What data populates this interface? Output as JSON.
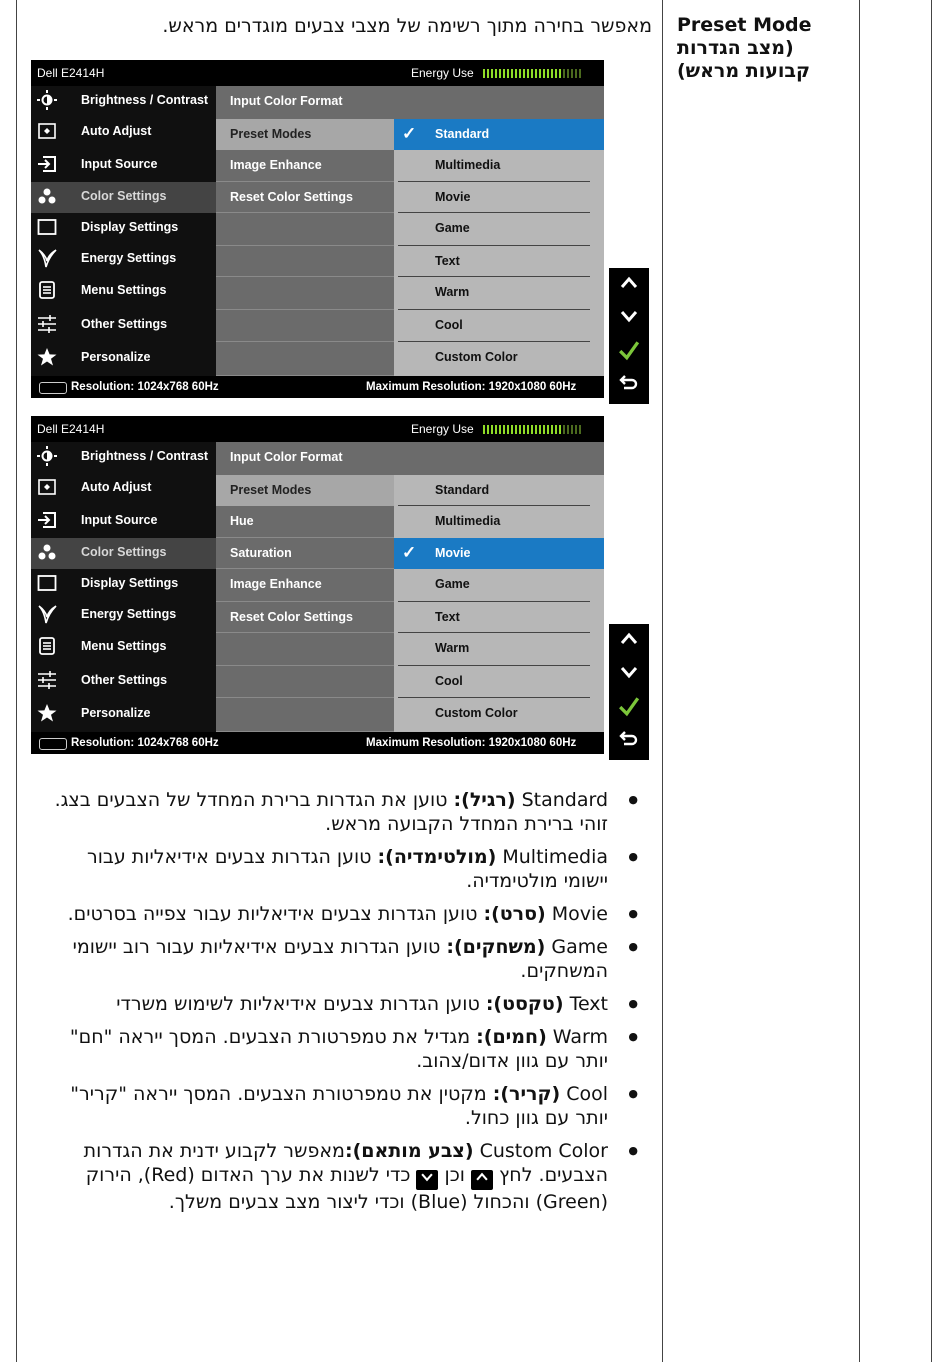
{
  "term": {
    "line1": "Preset Mode",
    "line2": "(מצב הגדרות",
    "line3": "קבועות מראש)"
  },
  "intro": "מאפשר בחירה מתוך רשימה של מצבי צבעים מוגדרים מראש.",
  "osd": [
    {
      "model": "Dell E2414H",
      "energy_label": "Energy Use",
      "energy_level": 0.8,
      "menu": [
        {
          "label": "Brightness / Contrast",
          "icon": "brightness-icon"
        },
        {
          "label": "Auto Adjust",
          "icon": "auto-adjust-icon"
        },
        {
          "label": "Input Source",
          "icon": "input-source-icon"
        },
        {
          "label": "Color Settings",
          "icon": "color-settings-icon",
          "selected": true
        },
        {
          "label": "Display Settings",
          "icon": "display-settings-icon"
        },
        {
          "label": "Energy Settings",
          "icon": "energy-icon"
        },
        {
          "label": "Menu Settings",
          "icon": "menu-icon"
        },
        {
          "label": "Other Settings",
          "icon": "other-settings-icon"
        },
        {
          "label": "Personalize",
          "icon": "star-icon"
        }
      ],
      "submenu": [
        "Input Color Format",
        "Preset Modes",
        "Image Enhance",
        "Reset Color Settings",
        "",
        "",
        "",
        "",
        ""
      ],
      "submenu_selected": 1,
      "options": [
        "",
        "Standard",
        "Multimedia",
        "Movie",
        "Game",
        "Text",
        "Warm",
        "Cool",
        "Custom Color"
      ],
      "option_selected": 1,
      "resolution": "Resolution:  1024x768 60Hz",
      "max_resolution": "Maximum Resolution: 1920x1080 60Hz"
    },
    {
      "model": "Dell E2414H",
      "energy_label": "Energy Use",
      "energy_level": 0.8,
      "menu": [
        {
          "label": "Brightness / Contrast",
          "icon": "brightness-icon"
        },
        {
          "label": "Auto Adjust",
          "icon": "auto-adjust-icon"
        },
        {
          "label": "Input Source",
          "icon": "input-source-icon"
        },
        {
          "label": "Color Settings",
          "icon": "color-settings-icon",
          "selected": true
        },
        {
          "label": "Display Settings",
          "icon": "display-settings-icon"
        },
        {
          "label": "Energy Settings",
          "icon": "energy-icon"
        },
        {
          "label": "Menu Settings",
          "icon": "menu-icon"
        },
        {
          "label": "Other Settings",
          "icon": "other-settings-icon"
        },
        {
          "label": "Personalize",
          "icon": "star-icon"
        }
      ],
      "submenu": [
        "Input Color Format",
        "Preset Modes",
        "Hue",
        "Saturation",
        "Image Enhance",
        "Reset Color Settings",
        "",
        "",
        ""
      ],
      "submenu_selected": 1,
      "options": [
        "",
        "Standard",
        "Multimedia",
        "Movie",
        "Game",
        "Text",
        "Warm",
        "Cool",
        "Custom Color"
      ],
      "option_selected": 3,
      "resolution": "Resolution:  1024x768 60Hz",
      "max_resolution": "Maximum Resolution: 1920x1080 60Hz"
    }
  ],
  "buttons": [
    "up-icon",
    "down-icon",
    "check-icon",
    "back-icon"
  ],
  "bullets": [
    {
      "en": "Standard",
      "he_bold": "(רגיל):",
      "text": " טוען את הגדרות ברירת המחדל של הצבעים בצג. זוהי ברירת המחדל הקבועה מראש."
    },
    {
      "en": "Multimedia",
      "he_bold": "(מולטימדיה):",
      "text": " טוען הגדרות צבעים אידיאליות עבור יישומי מולטימדיה."
    },
    {
      "en": "Movie",
      "he_bold": "(סרט):",
      "text": " טוען הגדרות צבעים אידיאליות עבור צפייה בסרטים."
    },
    {
      "en": "Game",
      "he_bold": "(משחקים):",
      "text": " טוען הגדרות צבעים אידיאליות עבור רוב יישומי המשחקים."
    },
    {
      "en": "Text",
      "he_bold": "(טקסט):",
      "text": " טוען הגדרות צבעים אידיאליות לשימוש משרדי"
    },
    {
      "en": "Warm",
      "he_bold": "(חמים):",
      "text": " מגדיל את טמפרטורת הצבעים. המסך ייראה \"חם\" יותר עם גוון אדום/צהוב."
    },
    {
      "en": "Cool",
      "he_bold": "(קריר):",
      "text": " מקטין את טמפרטורת הצבעים. המסך ייראה \"קריר\" יותר עם גוון כחול."
    }
  ],
  "custom": {
    "en": "Custom Color",
    "he_bold": "(צבע מותאם):",
    "text1": "מאפשר לקבוע ידנית את הגדרות הצבעים. לחץ",
    "and": "וכן",
    "text2": "כדי לשנות את ערך האדום (Red), הירוק (Green) והכחול (Blue) וכדי ליצור מצב צבעים משלך."
  }
}
